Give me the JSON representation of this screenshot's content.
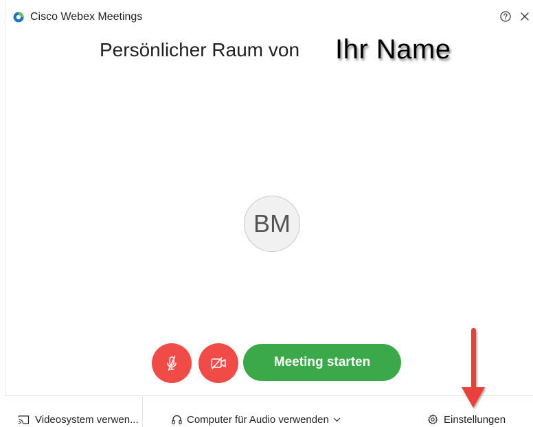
{
  "window": {
    "title": "Cisco Webex Meetings"
  },
  "room": {
    "title_prefix": "Persönlicher Raum von",
    "owner_name": "Ihr Name"
  },
  "avatar": {
    "initials": "BM"
  },
  "controls": {
    "start_label": "Meeting starten"
  },
  "bottom_bar": {
    "video_system_label": "Videosystem verwen...",
    "audio_label": "Computer für Audio verwenden",
    "settings_label": "Einstellungen"
  },
  "colors": {
    "accent_red": "#f04b46",
    "start_green": "#3ba84a",
    "annotation_arrow": "#e8403d",
    "logo_blue": "#1f76bd",
    "logo_green": "#63c05b"
  },
  "icons": {
    "app": "webex-logo-icon",
    "help": "help-icon",
    "close": "close-icon",
    "mute": "microphone-muted-icon",
    "video": "video-off-icon",
    "cast": "cast-screen-icon",
    "audio": "headset-icon",
    "dropdown": "chevron-down-icon",
    "settings": "gear-icon",
    "annotation": "red-arrow-down-icon"
  }
}
